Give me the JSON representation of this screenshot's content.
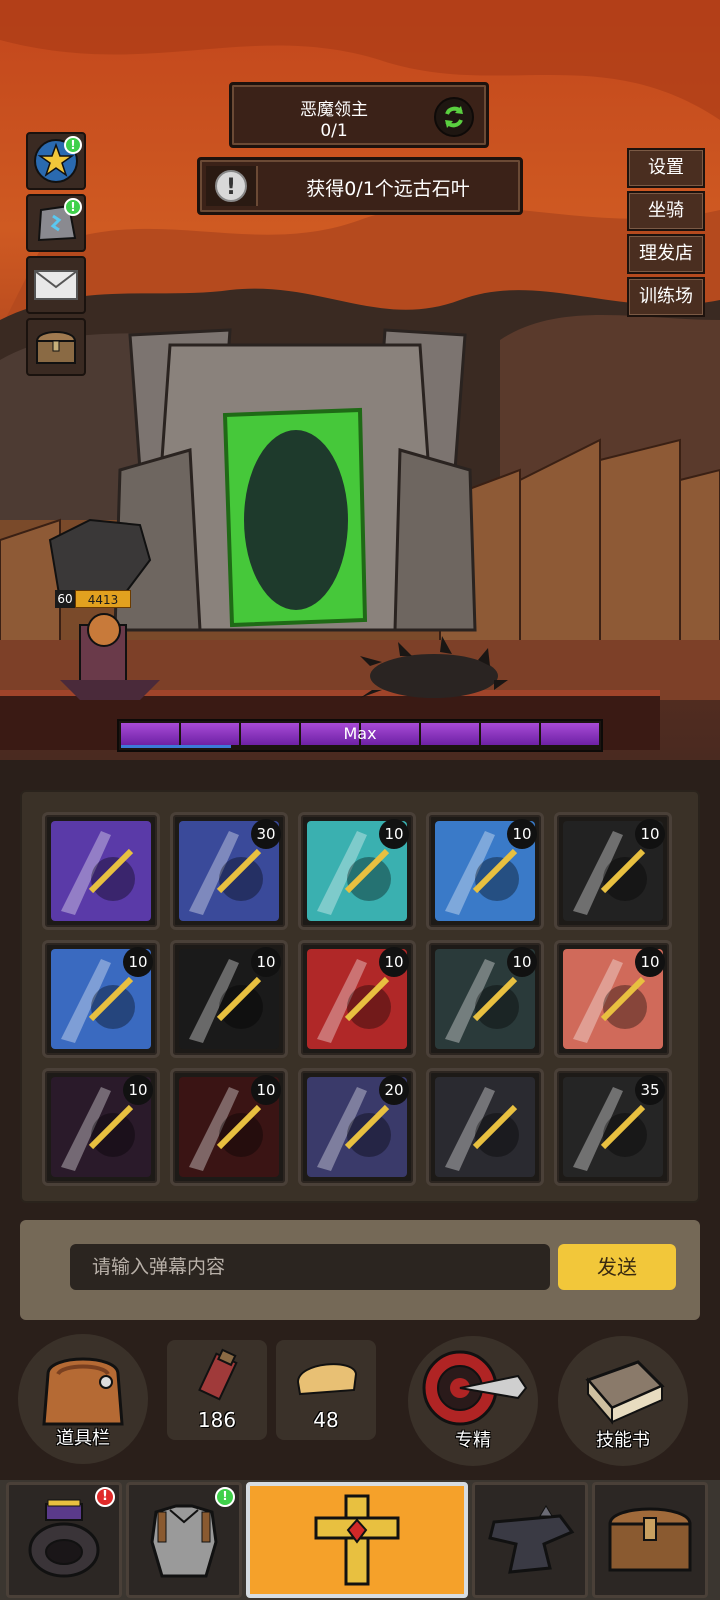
{
  "boss": {
    "name": "恶魔领主",
    "count": "0/1"
  },
  "quest": {
    "text": "获得0/1个远古石叶",
    "icon": "exclamation-icon"
  },
  "left_buttons": [
    {
      "name": "star-icon",
      "badge": "!"
    },
    {
      "name": "rune-stone-icon",
      "badge": "!"
    },
    {
      "name": "mail-icon"
    },
    {
      "name": "chest-icon"
    }
  ],
  "right_menu": [
    "设置",
    "坐骑",
    "理发店",
    "训练场"
  ],
  "player": {
    "level": "60",
    "power": "4413"
  },
  "progress": {
    "label": "Max",
    "segments": 8
  },
  "skills": [
    {
      "icon": "lightning-spear-icon",
      "level": "",
      "bg": "#5a3aa8"
    },
    {
      "icon": "holy-scepter-icon",
      "level": "30",
      "bg": "#3a4a9a"
    },
    {
      "icon": "beast-warrior-icon",
      "level": "10",
      "bg": "#3ab0b0"
    },
    {
      "icon": "shadow-fist-icon",
      "level": "10",
      "bg": "#3a7ac8"
    },
    {
      "icon": "iron-claw-icon",
      "level": "10",
      "bg": "#222222"
    },
    {
      "icon": "thunder-cloak-icon",
      "level": "10",
      "bg": "#3a6ac0"
    },
    {
      "icon": "dark-blade-icon",
      "level": "10",
      "bg": "#1a1a1a"
    },
    {
      "icon": "blood-mask-icon",
      "level": "10",
      "bg": "#b02828"
    },
    {
      "icon": "skull-crown-icon",
      "level": "10",
      "bg": "#2a3a3a"
    },
    {
      "icon": "fire-fist-icon",
      "level": "10",
      "bg": "#d06a5a"
    },
    {
      "icon": "shadow-wolf-icon",
      "level": "10",
      "bg": "#2a1a2a"
    },
    {
      "icon": "red-slash-icon",
      "level": "10",
      "bg": "#3a1414"
    },
    {
      "icon": "triple-spear-icon",
      "level": "20",
      "bg": "#3a3a6a"
    },
    {
      "icon": "frost-vortex-icon",
      "level": "",
      "bg": "#2a2a30"
    },
    {
      "icon": "golden-spear-icon",
      "level": "35",
      "bg": "#252525"
    }
  ],
  "chat": {
    "placeholder": "请输入弹幕内容",
    "send": "发送"
  },
  "actions": {
    "inventory": "道具栏",
    "potion_count": "186",
    "bread_count": "48",
    "mastery": "专精",
    "skill_book": "技能书"
  },
  "tabs": [
    {
      "icon": "ring-icon",
      "badge": "!"
    },
    {
      "icon": "armor-icon",
      "badge": "!"
    },
    {
      "icon": "golden-cross-icon",
      "active": true
    },
    {
      "icon": "anvil-icon"
    },
    {
      "icon": "treasure-chest-icon"
    }
  ],
  "colors": {
    "accent": "#f5a12a",
    "send": "#f2c73a",
    "progress": "#8a36c0"
  }
}
